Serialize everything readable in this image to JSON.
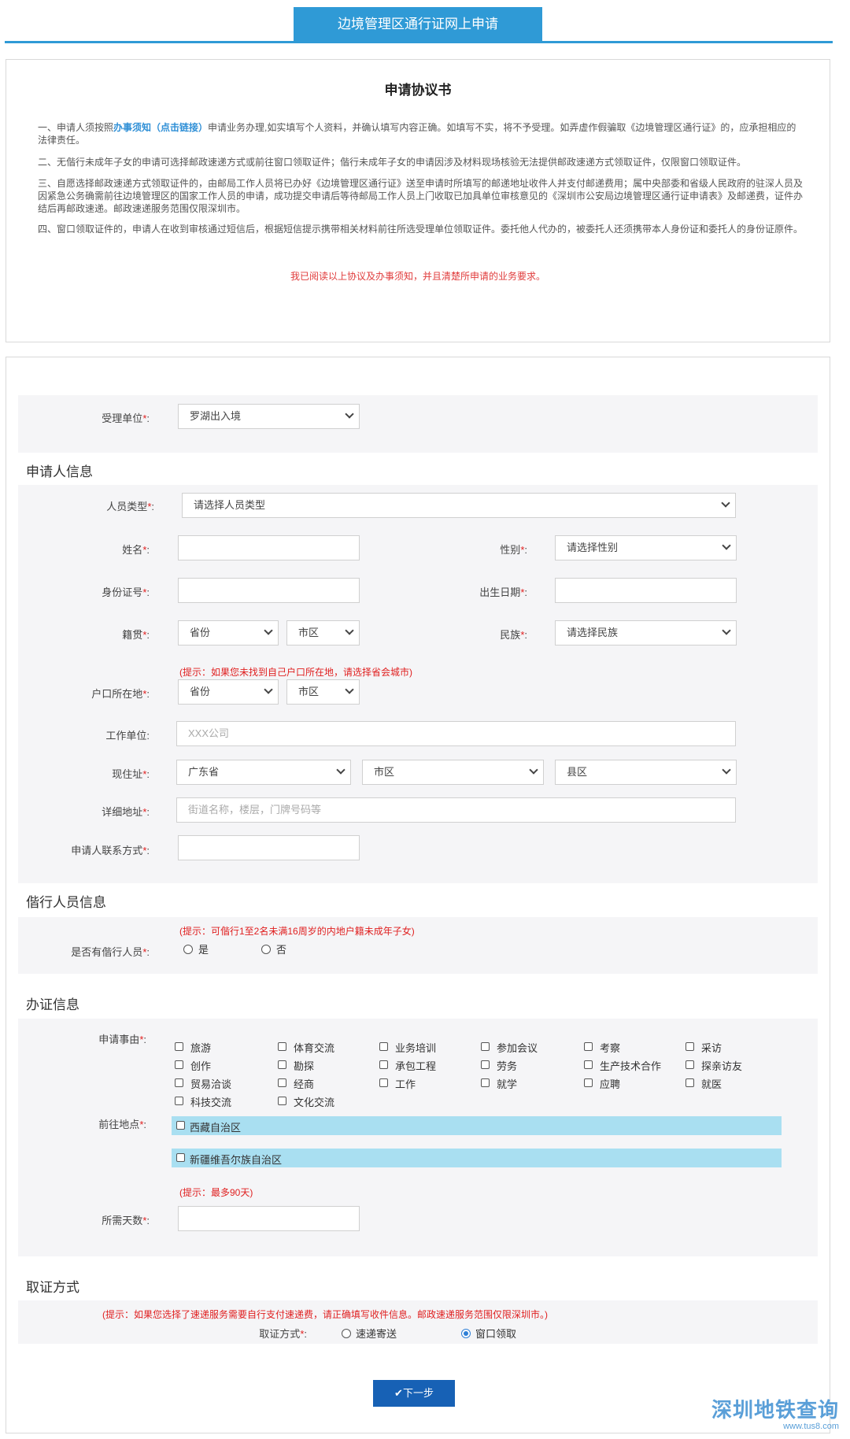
{
  "header": {
    "title": "边境管理区通行证网上申请"
  },
  "agreement": {
    "title": "申请协议书",
    "p1_prefix": "一、申请人须按照",
    "p1_link": "办事须知（点击链接）",
    "p1_suffix": "申请业务办理,如实填写个人资料，并确认填写内容正确。如填写不实，将不予受理。如弄虚作假骗取《边境管理区通行证》的，应承担相应的法律责任。",
    "p2": "二、无偕行未成年子女的申请可选择邮政速递方式或前往窗口领取证件；偕行未成年子女的申请因涉及材料现场核验无法提供邮政速递方式领取证件，仅限窗口领取证件。",
    "p3": "三、自愿选择邮政速递方式领取证件的，由邮局工作人员将已办好《边境管理区通行证》送至申请时所填写的邮递地址收件人并支付邮递费用；属中央部委和省级人民政府的驻深人员及因紧急公务确需前往边境管理区的国家工作人员的申请，成功提交申请后等待邮局工作人员上门收取已加具单位审核意见的《深圳市公安局边境管理区通行证申请表》及邮递费，证件办结后再邮政速递。邮政速递服务范围仅限深圳市。",
    "p4": "四、窗口领取证件的，申请人在收到审核通过短信后，根据短信提示携带相关材料前往所选受理单位领取证件。委托他人代办的，被委托人还须携带本人身份证和委托人的身份证原件。",
    "confirm": "我已阅读以上协议及办事须知，并且清楚所申请的业务要求。"
  },
  "req_mark": "*",
  "colon": ":",
  "unit": {
    "label": "受理单位",
    "value": "罗湖出入境"
  },
  "applicant": {
    "section_title": "申请人信息",
    "person_type": {
      "label": "人员类型",
      "value": "请选择人员类型"
    },
    "name": {
      "label": "姓名",
      "value": ""
    },
    "gender": {
      "label": "性别",
      "value": "请选择性别"
    },
    "id_no": {
      "label": "身份证号",
      "value": ""
    },
    "birth": {
      "label": "出生日期",
      "value": ""
    },
    "native": {
      "label": "籍贯",
      "province": "省份",
      "city": "市区"
    },
    "ethnic": {
      "label": "民族",
      "value": "请选择民族"
    },
    "hukou_hint": "(提示：如果您未找到自己户口所在地，请选择省会城市)",
    "hukou": {
      "label": "户口所在地",
      "province": "省份",
      "city": "市区"
    },
    "work": {
      "label": "工作单位",
      "placeholder": "XXX公司"
    },
    "address": {
      "label": "现住址",
      "province": "广东省",
      "city": "市区",
      "district": "县区"
    },
    "detail_addr": {
      "label": "详细地址",
      "placeholder": "街道名称，楼层，门牌号码等"
    },
    "contact": {
      "label": "申请人联系方式",
      "value": ""
    }
  },
  "companion": {
    "section_title": "偕行人员信息",
    "hint": "(提示：可偕行1至2名未满16周岁的内地户籍未成年子女)",
    "label": "是否有偕行人员",
    "options": [
      "是",
      "否"
    ]
  },
  "permit": {
    "section_title": "办证信息",
    "reason_label": "申请事由",
    "reasons": [
      "旅游",
      "体育交流",
      "业务培训",
      "参加会议",
      "考察",
      "采访",
      "创作",
      "勘探",
      "承包工程",
      "劳务",
      "生产技术合作",
      "探亲访友",
      "贸易洽谈",
      "经商",
      "工作",
      "就学",
      "应聘",
      "就医",
      "科技交流",
      "文化交流"
    ],
    "dest_label": "前往地点",
    "destinations": [
      "西藏自治区",
      "新疆维吾尔族自治区"
    ],
    "days_hint": "(提示：最多90天)",
    "days_label": "所需天数",
    "days_value": ""
  },
  "pickup": {
    "section_title": "取证方式",
    "hint": "(提示：如果您选择了速递服务需要自行支付速递费，请正确填写收件信息。邮政速递服务范围仅限深圳市。)",
    "label": "取证方式",
    "options": [
      "速递寄送",
      "窗口领取"
    ],
    "selected": "窗口领取"
  },
  "next_button": "✔下一步",
  "watermark": {
    "main": "深圳地铁查询",
    "sub": "www.tus8.com"
  },
  "colors": {
    "accent": "#2f9ad6",
    "button": "#1761b5",
    "required": "#e02020",
    "dest_bar": "#a9dff1"
  }
}
